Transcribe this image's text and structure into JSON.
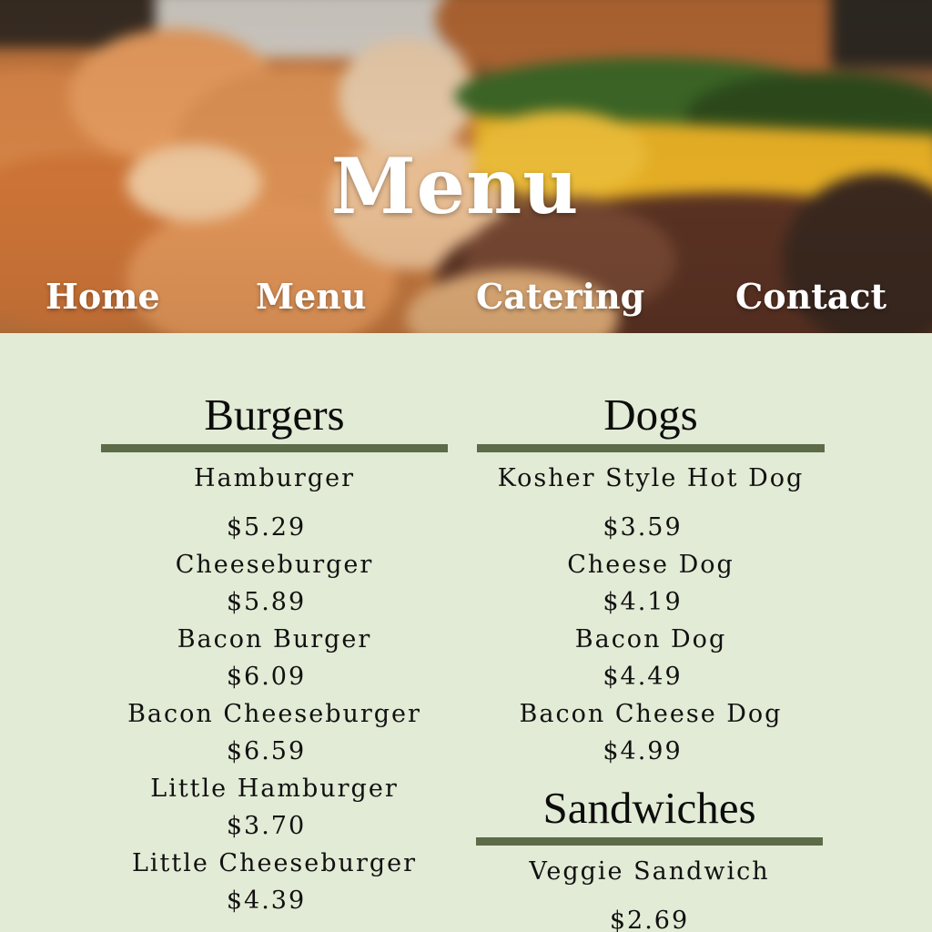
{
  "hero": {
    "title": "Menu"
  },
  "nav": {
    "items": [
      {
        "label": "Home"
      },
      {
        "label": "Menu"
      },
      {
        "label": "Catering"
      },
      {
        "label": "Contact"
      }
    ]
  },
  "sections": {
    "burgers": {
      "title": "Burgers",
      "items": [
        {
          "name": "Hamburger",
          "price": "$5.29"
        },
        {
          "name": "Cheeseburger",
          "price": "$5.89"
        },
        {
          "name": "Bacon Burger",
          "price": "$6.09"
        },
        {
          "name": "Bacon Cheeseburger",
          "price": "$6.59"
        },
        {
          "name": "Little Hamburger",
          "price": "$3.70"
        },
        {
          "name": "Little Cheeseburger",
          "price": "$4.39"
        }
      ]
    },
    "dogs": {
      "title": "Dogs",
      "items": [
        {
          "name": "Kosher Style Hot Dog",
          "price": "$3.59"
        },
        {
          "name": "Cheese Dog",
          "price": "$4.19"
        },
        {
          "name": "Bacon Dog",
          "price": "$4.49"
        },
        {
          "name": "Bacon Cheese Dog",
          "price": "$4.99"
        }
      ]
    },
    "sandwiches": {
      "title": "Sandwiches",
      "items": [
        {
          "name": "Veggie Sandwich",
          "price": "$2.69"
        }
      ]
    }
  },
  "colors": {
    "page_background": "#e2ebd5",
    "section_rule": "#5c6b48",
    "hero_text": "#ffffff",
    "body_text": "#111111"
  }
}
